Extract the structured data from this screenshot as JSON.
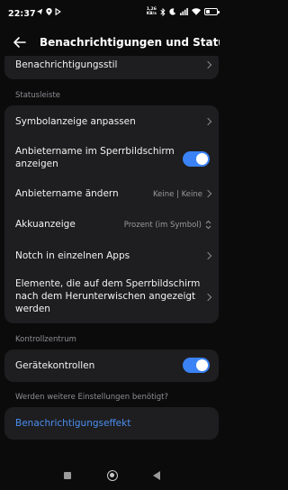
{
  "status_bar": {
    "time": "22:37",
    "net_speed_value": "1,26",
    "net_speed_unit": "KB/s",
    "icons": [
      "telegram-icon",
      "location-icon",
      "play-icon",
      "bluetooth-icon",
      "moon-icon",
      "signal-icon",
      "wifi-icon",
      "battery-icon"
    ],
    "battery_level": 0.4
  },
  "header": {
    "title": "Benachrichtigungen und Statusle…",
    "back_icon": "arrow-left-icon"
  },
  "rows": {
    "notification_style": "Benachrichtigungsstil",
    "icon_display": "Symbolanzeige anpassen",
    "provider_lock_line1": "Anbietername im Sperrbildschirm",
    "provider_lock_line2": "anzeigen",
    "provider_lock_on": true,
    "change_provider": "Anbietername ändern",
    "change_provider_value": "Keine | Keine",
    "battery": "Akkuanzeige",
    "battery_value": "Prozent (im Symbol)",
    "notch": "Notch in einzelnen Apps",
    "lock_elements_line1": "Elemente, die auf dem Sperrbildschirm",
    "lock_elements_line2": "nach dem Herunterwischen angezeigt",
    "lock_elements_line3": "werden",
    "device_controls": "Gerätekontrollen",
    "device_controls_on": true,
    "notification_effect": "Benachrichtigungseffekt"
  },
  "sections": {
    "statusbar": "Statusleiste",
    "control_center": "Kontrollzentrum",
    "more_settings": "Werden weitere Einstellungen benötigt?"
  },
  "colors": {
    "accent": "#3b82f6",
    "card": "#1e1e20",
    "background": "#0b0b0c",
    "link": "#4b8ef0"
  },
  "nav": {
    "icons": [
      "recents-square-icon",
      "home-circle-icon",
      "back-triangle-icon"
    ]
  }
}
